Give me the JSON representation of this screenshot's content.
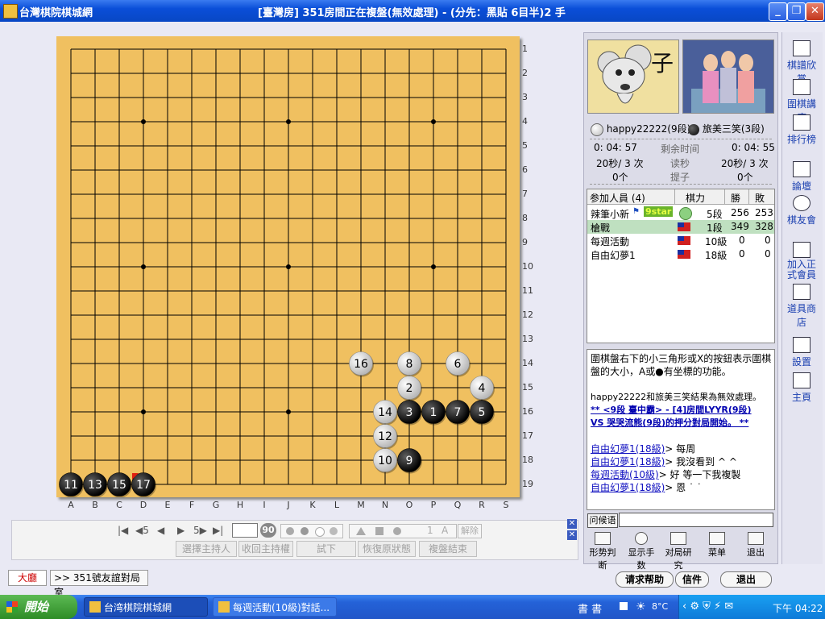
{
  "window": {
    "app_name": "台灣棋院棋城網",
    "title": "[臺灣房]  351房間正在複盤(無效處理) - (分先：黑貼 6目半)2 手",
    "minimize": "_",
    "restore": "❐",
    "close": "✕"
  },
  "board": {
    "size": 19,
    "col_labels": [
      "A",
      "B",
      "C",
      "D",
      "E",
      "F",
      "G",
      "H",
      "I",
      "J",
      "K",
      "L",
      "M",
      "N",
      "O",
      "P",
      "Q",
      "R",
      "S"
    ],
    "row_labels": [
      "1",
      "2",
      "3",
      "4",
      "5",
      "6",
      "7",
      "8",
      "9",
      "10",
      "11",
      "12",
      "13",
      "14",
      "15",
      "16",
      "17",
      "18",
      "19"
    ],
    "stones": [
      {
        "color": "white",
        "col": "M",
        "row": "14",
        "n": "16"
      },
      {
        "color": "white",
        "col": "O",
        "row": "14",
        "n": "8"
      },
      {
        "color": "white",
        "col": "Q",
        "row": "14",
        "n": "6"
      },
      {
        "color": "white",
        "col": "O",
        "row": "15",
        "n": "2"
      },
      {
        "color": "white",
        "col": "R",
        "row": "15",
        "n": "4"
      },
      {
        "color": "white",
        "col": "N",
        "row": "16",
        "n": "14"
      },
      {
        "color": "black",
        "col": "O",
        "row": "16",
        "n": "3"
      },
      {
        "color": "black",
        "col": "P",
        "row": "16",
        "n": "1"
      },
      {
        "color": "black",
        "col": "Q",
        "row": "16",
        "n": "7"
      },
      {
        "color": "black",
        "col": "R",
        "row": "16",
        "n": "5"
      },
      {
        "color": "white",
        "col": "N",
        "row": "17",
        "n": "12"
      },
      {
        "color": "white",
        "col": "N",
        "row": "18",
        "n": "10"
      },
      {
        "color": "black",
        "col": "O",
        "row": "18",
        "n": "9"
      },
      {
        "color": "black",
        "col": "A",
        "row": "19",
        "n": "11"
      },
      {
        "color": "black",
        "col": "B",
        "row": "19",
        "n": "13"
      },
      {
        "color": "black",
        "col": "C",
        "row": "19",
        "n": "15"
      },
      {
        "color": "black",
        "col": "D",
        "row": "19",
        "n": "17"
      }
    ],
    "colors": {
      "wood": "#f0c060",
      "line": "#000000"
    }
  },
  "controls": {
    "first": "|◀",
    "back5": "◀5",
    "back": "◀",
    "fwd": "▶",
    "fwd5": "5▶",
    "last": "▶|",
    "move_no": "",
    "go_badge": "90",
    "size_a": "1",
    "size_b": "A",
    "dismiss": "解除",
    "btn_host": "選擇主持人",
    "btn_revoke": "收回主持權",
    "btn_try": "試下",
    "btn_restore": "恢復原狀態",
    "btn_end": "複盤結束"
  },
  "tabs": {
    "lobby": "大廳",
    "room": ">> 351號友誼對局室"
  },
  "bottom_buttons": {
    "help": "请求帮助",
    "mail": "信件",
    "exit": "退出"
  },
  "players": {
    "white_name": "happy22222(9段)",
    "black_name": "旅美三笑(3段)",
    "white_time": "0: 04: 57",
    "black_time": "0: 04: 55",
    "time_label": "剩余时间",
    "white_byoyomi": "20秒/ 3 次",
    "black_byoyomi": "20秒/ 3 次",
    "byoyomi_label": "读秒",
    "white_captures": "0个",
    "black_captures": "0个",
    "captures_label": "提子"
  },
  "participants": {
    "header": {
      "title": "参加人員 (4)",
      "rank": "棋力",
      "win": "勝",
      "loss": "敗"
    },
    "rows": [
      {
        "name": "辣筆小新",
        "badge": "9star",
        "rank": "5段",
        "win": "256",
        "loss": "253"
      },
      {
        "name": "槍戰",
        "rank": "1段",
        "win": "349",
        "loss": "328"
      },
      {
        "name": "每週活動",
        "rank": "10級",
        "win": "0",
        "loss": "0"
      },
      {
        "name": "自由幻夢1",
        "rank": "18級",
        "win": "0",
        "loss": "0"
      }
    ]
  },
  "chat": {
    "tip1": "圍棋盤右下的小三角形或X的按鈕表示圍棋",
    "tip2": "盤的大小，A或●有坐標的功能。",
    "result": "happy22222和旅美三笑結果為無效處理。",
    "sys1": "** <9段 臺中霸> - [4]房間LYYR(9段)",
    "sys2": "VS 哭哭流熊(9段)的押分對局開始。 **",
    "msgs": [
      {
        "name": "自由幻夢1(18級)",
        "text": "> 每周"
      },
      {
        "name": "自由幻夢1(18級)",
        "text": "> 我沒看到 ^ ^"
      },
      {
        "name": "每週活動(10級)",
        "text": "> 好 等一下我複製"
      },
      {
        "name": "自由幻夢1(18級)",
        "text": "> 恩 ˙ ˙"
      }
    ],
    "greet": "问候语",
    "input_value": ""
  },
  "tools": {
    "judge": "形势判断",
    "show_moves": "显示手数",
    "study": "对局研究",
    "menu": "菜单",
    "quit": "退出"
  },
  "sidebar": {
    "items": [
      "棋譜欣賞",
      "圍棋講座",
      "排行榜",
      "論壇",
      "棋友會",
      "加入正式會員",
      "道具商店",
      "設置",
      "主頁"
    ]
  },
  "taskbar": {
    "start": "開始",
    "task1": "台湾棋院棋城網",
    "task2": "每週活動(10級)對話...",
    "temp": "8°C",
    "clock": "下午 04:22"
  }
}
